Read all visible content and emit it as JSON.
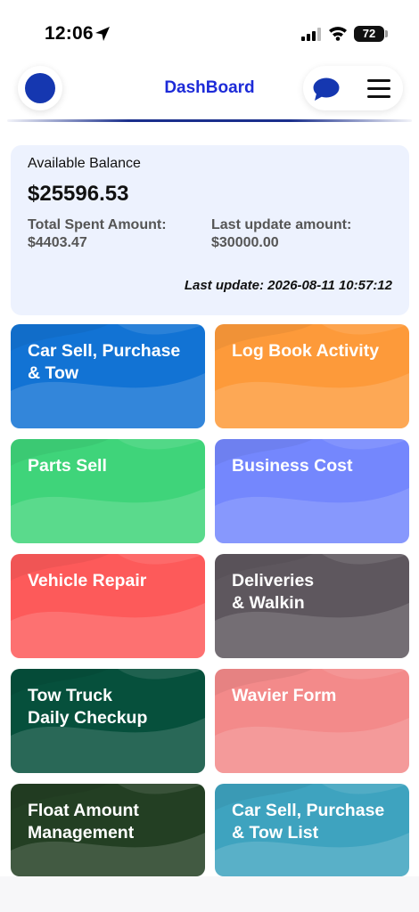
{
  "status_bar": {
    "time": "12:06",
    "battery": "72"
  },
  "header": {
    "title": "DashBoard"
  },
  "balance": {
    "label": "Available Balance",
    "amount": "$25596.53",
    "spent_label": "Total Spent Amount:",
    "spent_value": "$4403.47",
    "last_amount_label": "Last update amount:",
    "last_amount_value": "$30000.00",
    "last_update": "Last update: 2026-08-11 10:57:12"
  },
  "tiles": [
    {
      "label": "Car Sell, Purchase\n& Tow",
      "color": "#1273d4"
    },
    {
      "label": "Log Book Activity",
      "color": "#fd9a3a"
    },
    {
      "label": "Parts Sell",
      "color": "#3fd47a"
    },
    {
      "label": "Business Cost",
      "color": "#7487fd"
    },
    {
      "label": "Vehicle Repair",
      "color": "#fd5a5a"
    },
    {
      "label": "Deliveries\n& Walkin",
      "color": "#5e575e"
    },
    {
      "label": "Tow Truck\nDaily Checkup",
      "color": "#06503c"
    },
    {
      "label": "Wavier Form",
      "color": "#f38a8a"
    },
    {
      "label": "Float Amount\nManagement",
      "color": "#233f23"
    },
    {
      "label": "Car Sell, Purchase\n& Tow List",
      "color": "#3ea3bf"
    }
  ],
  "colors": {
    "accent": "#1d2bd8",
    "avatar": "#1537b0",
    "card_bg": "#edf2fe"
  }
}
